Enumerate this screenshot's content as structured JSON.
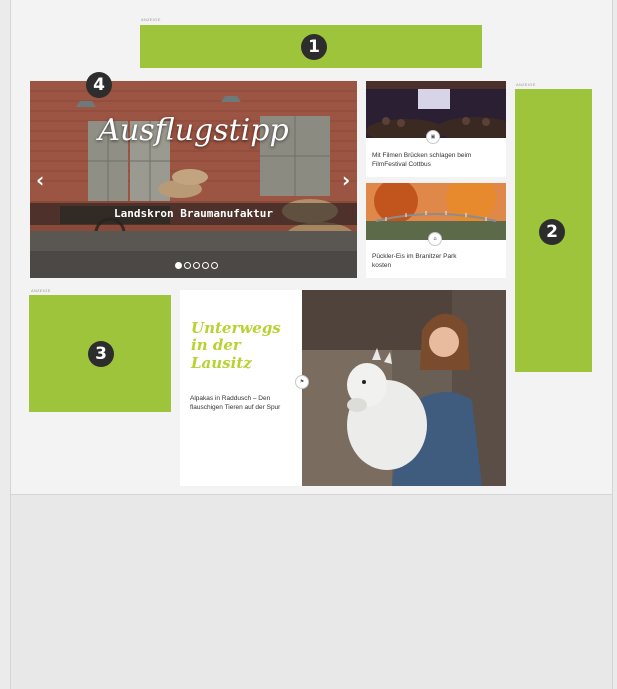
{
  "ads": {
    "label": "ANZEIGE",
    "markers": [
      "1",
      "2",
      "3",
      "4"
    ]
  },
  "slider": {
    "title": "Ausflugstipp",
    "subtitle": "Landskron Braumanufaktur",
    "prev_icon": "chevron-left-icon",
    "next_icon": "chevron-right-icon",
    "dot_count": 5,
    "active_dot": 0
  },
  "teasers": [
    {
      "text": "Mit Filmen Brücken schlagen beim FilmFestival Cottbus",
      "badge": ""
    },
    {
      "text": "Pückler-Eis im Branitzer Park kosten",
      "badge": ""
    }
  ],
  "feature": {
    "title": "Unterwegs in der Lausitz",
    "text": "Alpakas in Raddusch – Den flauschigen Tieren auf der Spur",
    "badge_icon": "signpost-icon"
  },
  "colors": {
    "ad_green": "#9dc43a",
    "title_green": "#b7d332",
    "marker_dark": "#2d2d2d"
  }
}
